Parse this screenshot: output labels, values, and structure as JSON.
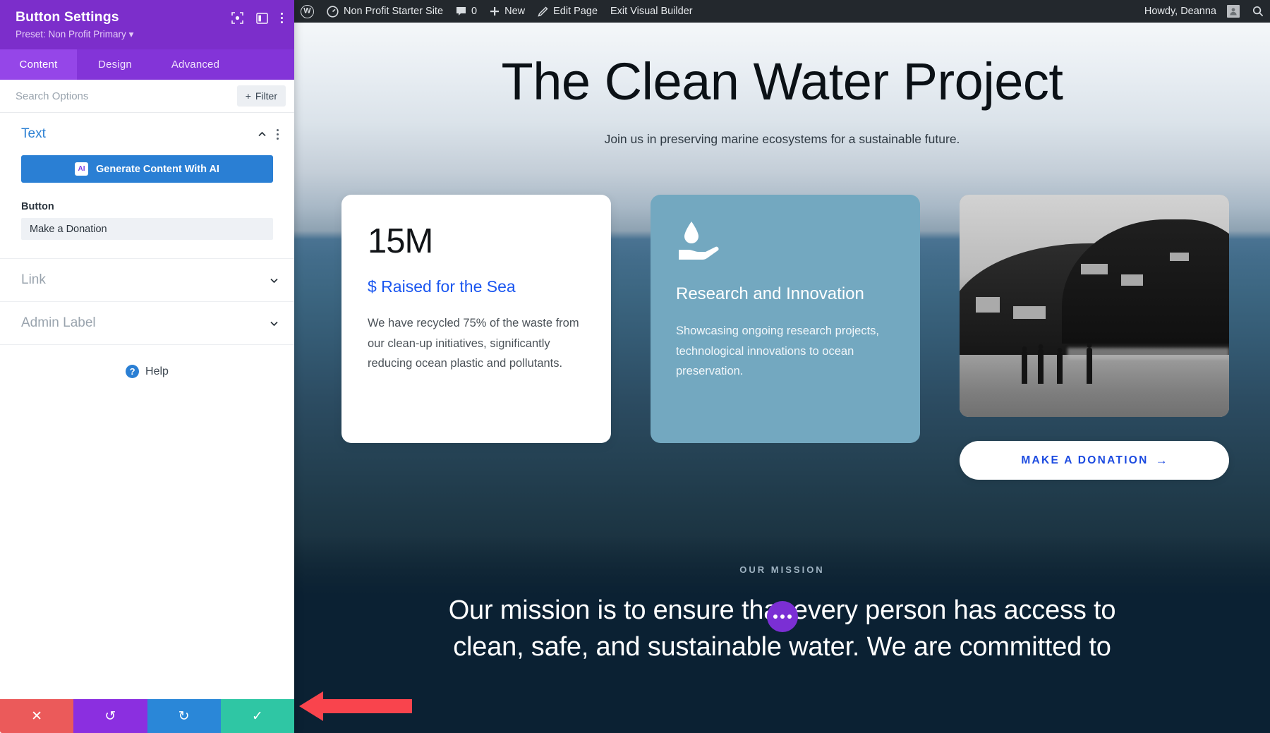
{
  "adminbar": {
    "wp_logo": "wordpress-logo",
    "site_name": "Non Profit Starter Site",
    "comments_count": "0",
    "new_label": "New",
    "edit_page_label": "Edit Page",
    "exit_builder_label": "Exit Visual Builder",
    "howdy": "Howdy, Deanna",
    "search_icon": "search-icon"
  },
  "sidebar": {
    "title": "Button Settings",
    "preset": "Preset: Non Profit Primary",
    "header_icons": [
      "focus-icon",
      "layout-icon",
      "kebab-menu-icon"
    ],
    "tabs": [
      {
        "label": "Content",
        "active": true
      },
      {
        "label": "Design",
        "active": false
      },
      {
        "label": "Advanced",
        "active": false
      }
    ],
    "search_placeholder": "Search Options",
    "search_value": "",
    "filter_label": "Filter",
    "sections": [
      {
        "title": "Text",
        "open": true
      },
      {
        "title": "Link",
        "open": false
      },
      {
        "title": "Admin Label",
        "open": false
      }
    ],
    "ai_button": "Generate Content With AI",
    "button_field_label": "Button",
    "button_field_value": "Make a Donation",
    "help_label": "Help",
    "footer_buttons": [
      {
        "name": "cancel",
        "glyph": "✕",
        "color": "#eb5a5a"
      },
      {
        "name": "undo",
        "glyph": "↺",
        "color": "#8b2fe0"
      },
      {
        "name": "redo",
        "glyph": "↻",
        "color": "#2a87d8"
      },
      {
        "name": "save",
        "glyph": "✓",
        "color": "#2fc6a4"
      }
    ]
  },
  "page": {
    "hero_title": "The Clean Water Project",
    "hero_subtitle": "Join us in preserving marine ecosystems for a sustainable future.",
    "card_stat": {
      "number": "15M",
      "label": "$ Raised for the Sea",
      "body": "We have recycled 75% of the waste from our clean-up initiatives, significantly reducing ocean plastic and pollutants."
    },
    "card_research": {
      "icon": "water-drop-in-hand-icon",
      "title": "Research and Innovation",
      "body": "Showcasing ongoing research projects, technological innovations to ocean preservation."
    },
    "card_photo": {
      "alt": "black-and-white coastal beach photo with people walking",
      "donate_button": "MAKE A DONATION",
      "donate_arrow": "→"
    },
    "mission_eyebrow": "OUR MISSION",
    "mission_text": "Our mission is to ensure that every person has access to clean, safe, and sustainable water. We are committed to",
    "fab": "more-options-fab"
  },
  "annotation": {
    "arrow": "red-left-arrow-pointing-to-save-button",
    "color": "#f9444d"
  }
}
